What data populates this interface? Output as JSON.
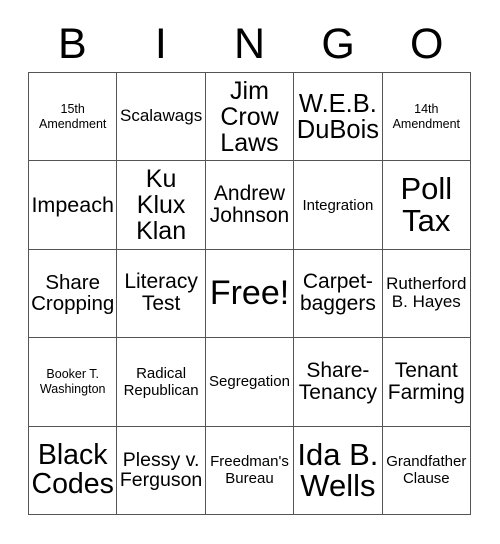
{
  "card": {
    "title_letters": [
      "B",
      "I",
      "N",
      "G",
      "O"
    ],
    "columns": 5,
    "rows": 5,
    "free_space": {
      "row": 3,
      "column": 3,
      "label": "Free!"
    },
    "theme": {
      "background": "#ffffff",
      "text_color": "#000000",
      "border_color": "#555555"
    }
  },
  "cells": [
    {
      "text": "15th Amendment",
      "size": "xs"
    },
    {
      "text": "Scalawags",
      "size": "m"
    },
    {
      "text": "Jim Crow Laws",
      "size": "xl"
    },
    {
      "text": "W.E.B. DuBois",
      "size": "xxl"
    },
    {
      "text": "14th Amendment",
      "size": "xs"
    },
    {
      "text": "Impeach",
      "size": "xl"
    },
    {
      "text": "Ku Klux Klan",
      "size": "xl"
    },
    {
      "text": "Andrew Johnson",
      "size": "l"
    },
    {
      "text": "Integration",
      "size": "s"
    },
    {
      "text": "Poll Tax",
      "size": "xxl"
    },
    {
      "text": "Share Cropping",
      "size": "l"
    },
    {
      "text": "Literacy Test",
      "size": "l"
    },
    {
      "text": "Free!",
      "size": "free"
    },
    {
      "text": "Carpet-baggers",
      "size": "l"
    },
    {
      "text": "Rutherford B. Hayes",
      "size": "m"
    },
    {
      "text": "Booker T. Washington",
      "size": "xs"
    },
    {
      "text": "Radical Republican",
      "size": "s"
    },
    {
      "text": "Segregation",
      "size": "s"
    },
    {
      "text": "Share-Tenancy",
      "size": "l"
    },
    {
      "text": "Tenant Farming",
      "size": "l"
    },
    {
      "text": "Black Codes",
      "size": "xxl"
    },
    {
      "text": "Plessy v. Ferguson",
      "size": "l"
    },
    {
      "text": "Freedman's Bureau",
      "size": "s"
    },
    {
      "text": "Ida B. Wells",
      "size": "xxl"
    },
    {
      "text": "Grandfather Clause",
      "size": "s"
    }
  ]
}
